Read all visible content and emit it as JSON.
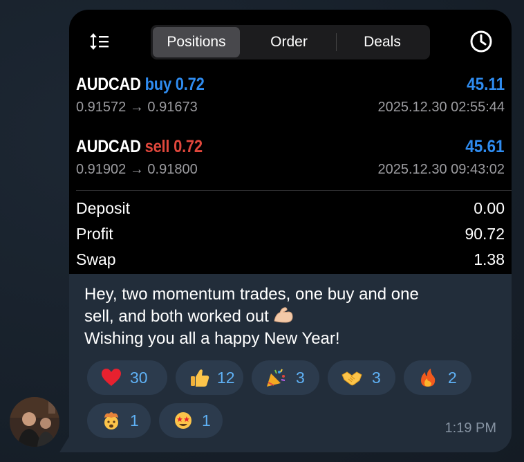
{
  "tabs": {
    "positions": "Positions",
    "order": "Order",
    "deals": "Deals"
  },
  "positions": [
    {
      "symbol": "AUDCAD",
      "side": "buy",
      "volume": "0.72",
      "profit": "45.11",
      "prices": "0.91572 → 0.91673",
      "time": "2025.12.30 02:55:44"
    },
    {
      "symbol": "AUDCAD",
      "side": "sell",
      "volume": "0.72",
      "profit": "45.61",
      "prices": "0.91902 → 0.91800",
      "time": "2025.12.30 09:43:02"
    }
  ],
  "summary": [
    {
      "label": "Deposit",
      "value": "0.00"
    },
    {
      "label": "Profit",
      "value": "90.72"
    },
    {
      "label": "Swap",
      "value": "1.38"
    }
  ],
  "message": {
    "line1": "Hey, two momentum trades, one buy and one",
    "line2": "sell, and both worked out",
    "line3": "Wishing you all a happy New Year!"
  },
  "reactions": [
    {
      "icon": "red-heart-icon",
      "count": "30"
    },
    {
      "icon": "thumbs-up-icon",
      "count": "12"
    },
    {
      "icon": "party-popper-icon",
      "count": "3"
    },
    {
      "icon": "handshake-icon",
      "count": "3"
    },
    {
      "icon": "fire-icon",
      "count": "2"
    },
    {
      "icon": "exploding-head-icon",
      "count": "1"
    },
    {
      "icon": "star-struck-icon",
      "count": "1"
    }
  ],
  "timestamp": "1:19 PM",
  "colors": {
    "buy": "#2f8cf0",
    "sell": "#e0473c",
    "profit": "#2f8cf0",
    "reaction_count": "#5fb1f5",
    "bubble": "#222d3a",
    "reaction_bg": "#2c3b4d"
  }
}
